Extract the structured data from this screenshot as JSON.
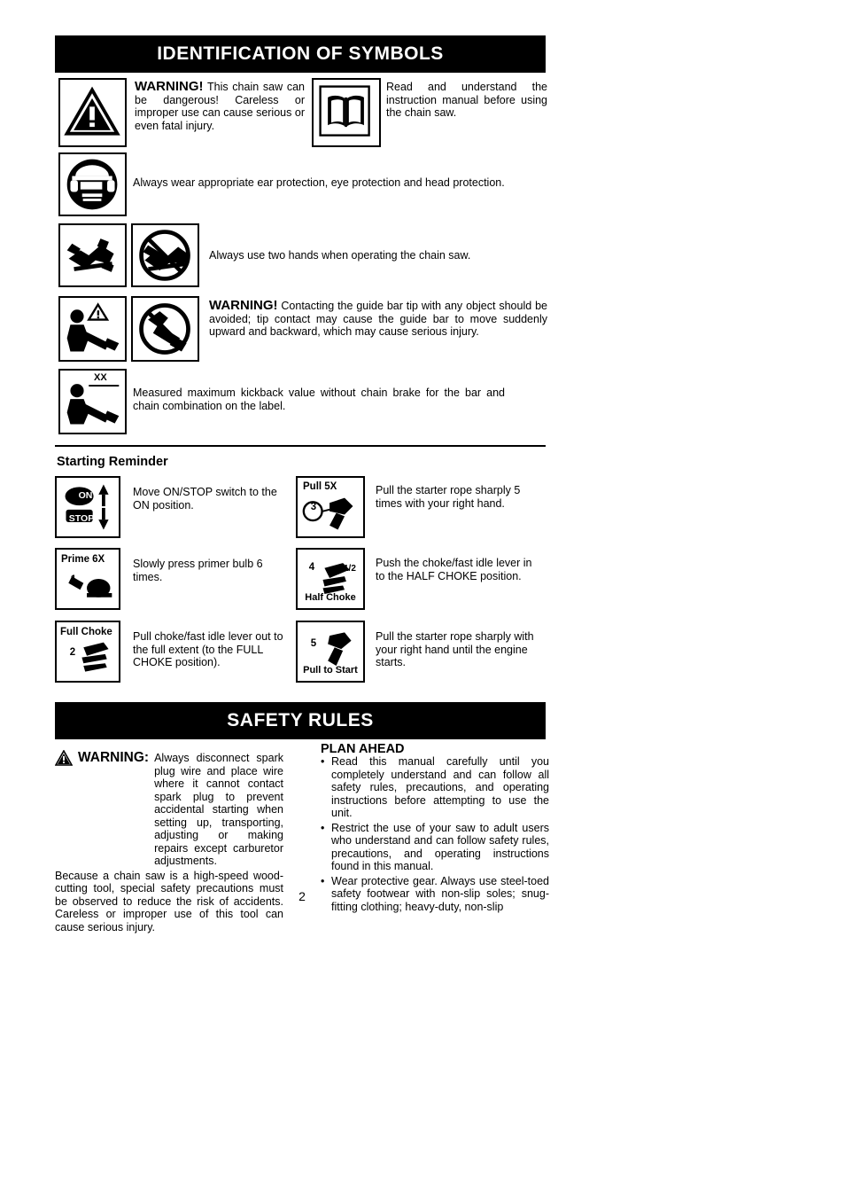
{
  "sections": {
    "identification": {
      "banner": "IDENTIFICATION OF SYMBOLS",
      "rows": [
        {
          "icon": "warning-triangle-icon",
          "label": "WARNING!",
          "text": "This chain saw can be dangerous! Careless or improper use can cause serious or even fatal injury."
        },
        {
          "icon": "open-manual-icon",
          "text": "Read and understand the instruction manual before using the chain saw."
        },
        {
          "icon": "head-ear-eye-protection-icon",
          "text": "Always wear appropriate ear protection, eye protection and head protection."
        },
        {
          "icon": "two-hands-icon",
          "icon2": "one-hand-prohibited-icon",
          "text": "Always use two hands when operating the chain saw."
        },
        {
          "icon": "kickback-bar-tip-icon",
          "icon2": "bar-tip-contact-prohibited-icon",
          "label": "WARNING!",
          "text": "Contacting the guide bar tip with any object should be avoided; tip contact may cause the guide bar to move suddenly upward and backward, which may cause serious injury."
        },
        {
          "icon": "kickback-measured-value-icon",
          "icon_text": "XX",
          "text": "Measured maximum kickback value without chain brake for the bar and chain combination on the label."
        }
      ]
    },
    "starting_reminder": {
      "title": "Starting Reminder",
      "steps": [
        {
          "icon": "on-stop-switch-icon",
          "icon_labels": [
            "ON",
            "STOP"
          ],
          "text": "Move ON/STOP switch to the ON position."
        },
        {
          "icon": "starter-rope-icon",
          "icon_labels": [
            "Pull 5X",
            "3"
          ],
          "text": "Pull the starter rope sharply 5 times with your right hand."
        },
        {
          "icon": "primer-bulb-icon",
          "icon_labels": [
            "Prime 6X",
            "1"
          ],
          "text": "Slowly press primer bulb 6 times."
        },
        {
          "icon": "half-choke-lever-icon",
          "icon_labels": [
            "4",
            "1/2",
            "Half Choke"
          ],
          "text": "Push the choke/fast idle lever in to the HALF CHOKE position."
        },
        {
          "icon": "full-choke-lever-icon",
          "icon_labels": [
            "Full Choke",
            "2"
          ],
          "text": "Pull choke/fast idle lever out to the full extent (to the FULL CHOKE position)."
        },
        {
          "icon": "pull-to-start-icon",
          "icon_labels": [
            "5",
            "Pull to Start"
          ],
          "text": "Pull the starter rope sharply with your right hand until the engine starts."
        }
      ]
    },
    "safety_rules": {
      "banner": "SAFETY RULES",
      "warning": {
        "icon": "warning-triangle-small-icon",
        "label": "WARNING:",
        "paragraphs": [
          "Always disconnect spark plug wire and place wire where it cannot contact spark plug to prevent accidental starting when setting up, transporting, adjusting or making repairs except carburetor adjustments.",
          "Because a chain saw is a high-speed wood-cutting tool, special safety precautions must be observed to reduce the risk of accidents. Careless or improper use of this tool can cause serious injury."
        ]
      },
      "plan_ahead": {
        "heading": "PLAN AHEAD",
        "bullets": [
          "Read this manual carefully until you completely understand and can follow all safety rules, precautions, and operating instructions before attempting to use the unit.",
          "Restrict the use of your saw to adult users who understand and can follow safety rules, precautions, and operating instructions found in this manual.",
          "Wear protective gear.  Always use steel-toed safety footwear with non-slip soles; snug-fitting clothing; heavy-duty, non-slip"
        ]
      }
    },
    "page_number": "2"
  }
}
